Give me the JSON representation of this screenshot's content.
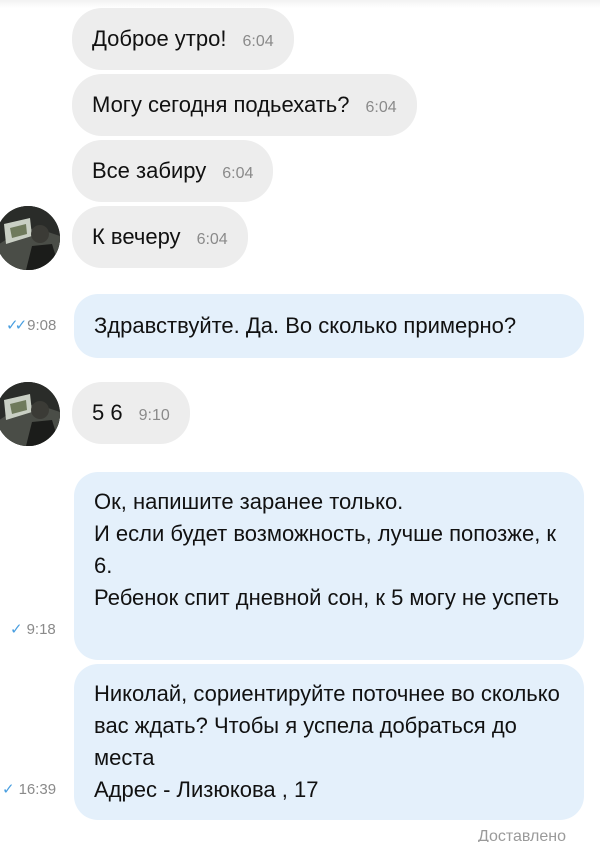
{
  "messages": [
    {
      "text": "Доброе утро!",
      "time": "6:04"
    },
    {
      "text": "Могу сегодня подьехать?",
      "time": "6:04"
    },
    {
      "text": "Все забиру",
      "time": "6:04"
    },
    {
      "text": "К вечеру",
      "time": "6:04"
    },
    {
      "text": "Здравствуйте. Да. Во сколько примерно?",
      "time": "9:08",
      "check": "✓✓"
    },
    {
      "text": "5 6",
      "time": "9:10"
    },
    {
      "text": "Ок, напишите заранее только.\nИ если будет возможность, лучше попозже, к 6.\nРебенок спит дневной сон, к 5 могу не успеть",
      "time": "9:18",
      "check": "✓"
    },
    {
      "text": "Николай, сориентируйте поточнее во сколько вас ждать? Чтобы я успела добраться до места\nАдрес - Лизюкова , 17",
      "time": "16:39",
      "check": "✓"
    }
  ],
  "status": "Доставлено",
  "colors": {
    "incoming_bubble": "#ededed",
    "outgoing_bubble": "#e4f0fb",
    "check": "#4a9fe0",
    "time": "#8a8a8a"
  },
  "icons": {
    "read_receipt": "double-check-icon",
    "sent_receipt": "check-icon",
    "contact_avatar": "avatar"
  }
}
